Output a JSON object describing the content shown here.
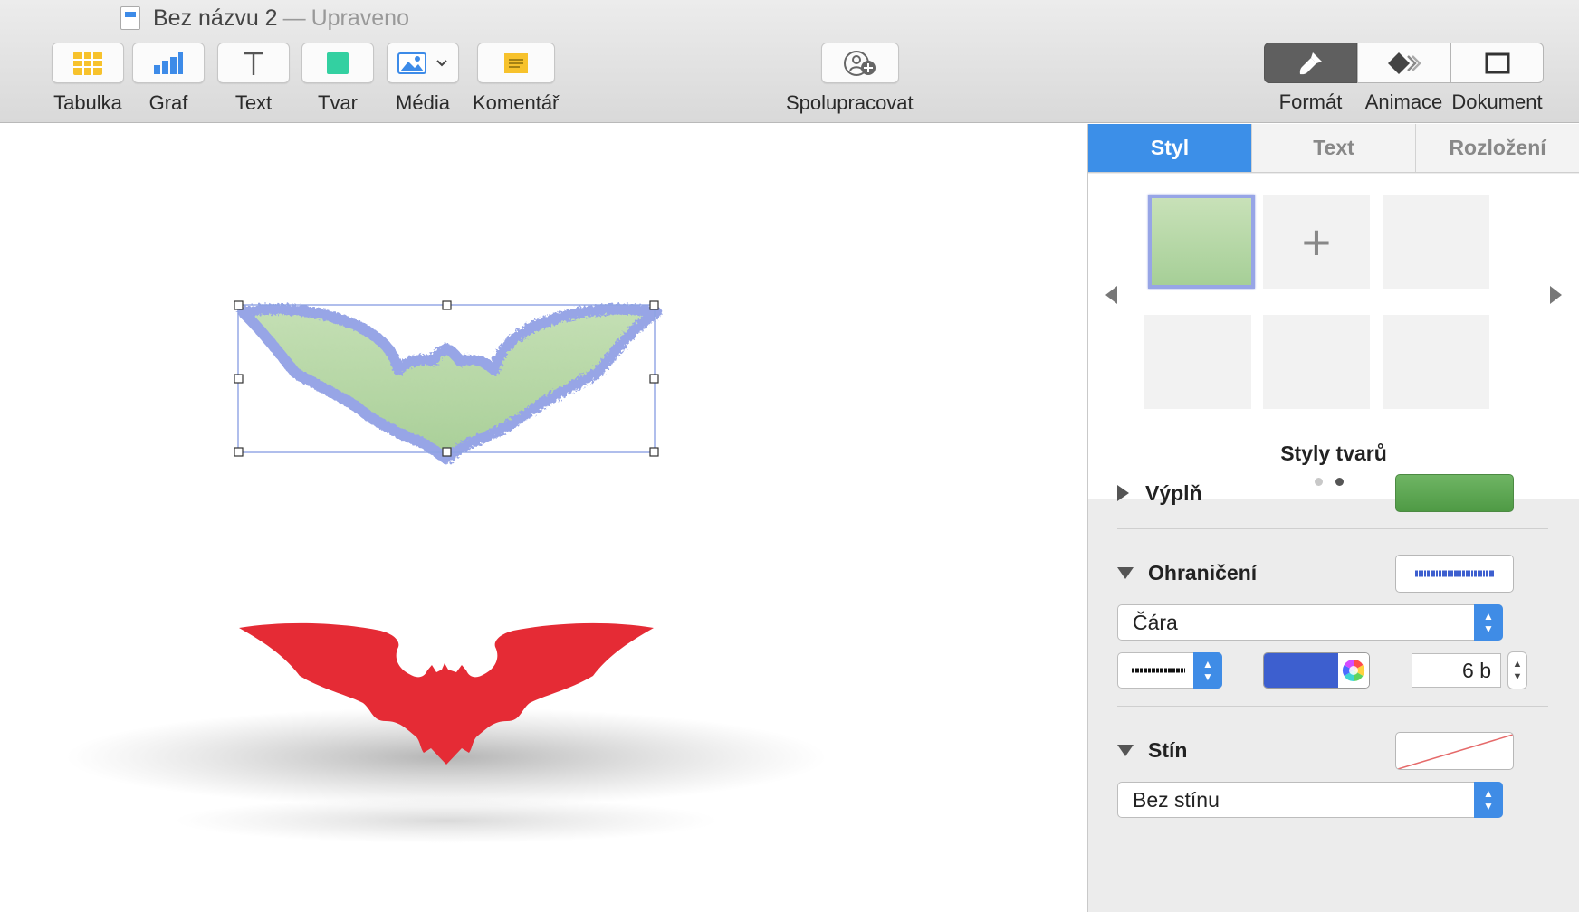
{
  "window": {
    "doc_name": "Bez názvu 2",
    "separator": "—",
    "status": "Upraveno"
  },
  "toolbar": {
    "items": [
      {
        "label": "Tabulka",
        "icon": "table-icon"
      },
      {
        "label": "Graf",
        "icon": "chart-icon"
      },
      {
        "label": "Text",
        "icon": "text-icon"
      },
      {
        "label": "Tvar",
        "icon": "shape-icon"
      },
      {
        "label": "Média",
        "icon": "media-icon"
      },
      {
        "label": "Komentář",
        "icon": "comment-icon"
      }
    ],
    "collaborate": {
      "label": "Spolupracovat",
      "icon": "collaborate-icon"
    },
    "inspector": [
      {
        "label": "Formát",
        "icon": "format-brush-icon",
        "active": true
      },
      {
        "label": "Animace",
        "icon": "animate-icon",
        "active": false
      },
      {
        "label": "Dokument",
        "icon": "document-icon",
        "active": false
      }
    ]
  },
  "panel": {
    "tabs": [
      {
        "label": "Styl",
        "active": true
      },
      {
        "label": "Text",
        "active": false
      },
      {
        "label": "Rozložení",
        "active": false
      }
    ],
    "styles_title": "Styly tvarů",
    "page_dots": {
      "count": 2,
      "current": 2
    },
    "fill": {
      "label": "Výplň",
      "color": "#5ea652"
    },
    "border": {
      "label": "Ohraničení",
      "type": "Čára",
      "color": "#3d5fcf",
      "width": "6 b"
    },
    "shadow": {
      "label": "Stín",
      "value": "Bez stínu"
    }
  },
  "canvas": {
    "shapes": [
      {
        "name": "green-bat-shape",
        "fill": "#b4d6a4",
        "stroke": "#97a5e6",
        "selected": true
      },
      {
        "name": "red-bat-shape",
        "fill": "#e52b35",
        "selected": false
      }
    ]
  }
}
